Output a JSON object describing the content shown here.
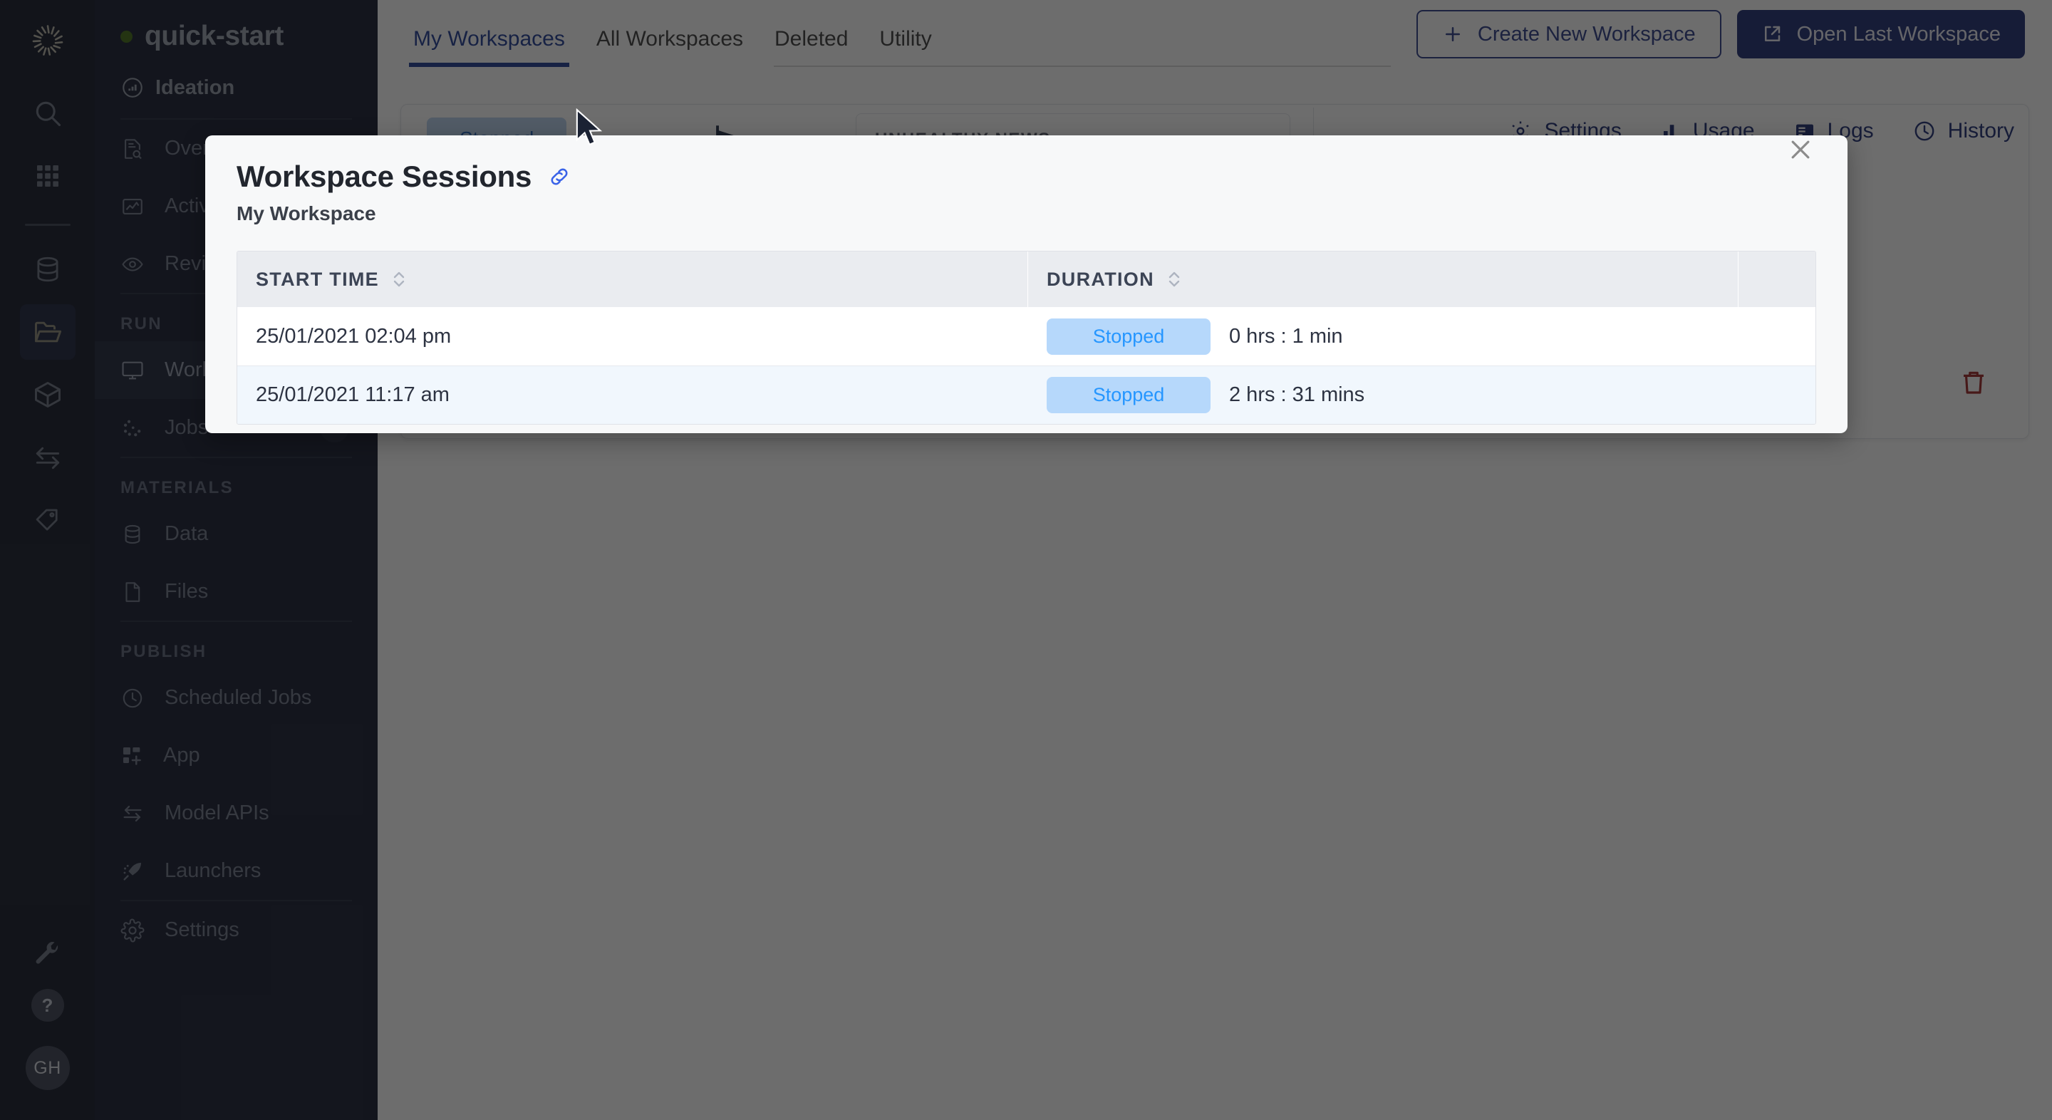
{
  "rail": {
    "logo_icon": "aperture-logo-icon",
    "items": [
      {
        "icon": "search-icon",
        "name": "search"
      },
      {
        "icon": "grid-apps-icon",
        "name": "apps"
      },
      {
        "icon": "database-icon",
        "name": "datasets"
      },
      {
        "icon": "folder-open-icon",
        "name": "projects",
        "active": true
      },
      {
        "icon": "cube-icon",
        "name": "environments"
      },
      {
        "icon": "arrows-exchange-icon",
        "name": "model-apis"
      },
      {
        "icon": "tag-icon",
        "name": "tags"
      },
      {
        "icon": "wrench-icon",
        "name": "admin"
      }
    ],
    "help_label": "?",
    "avatar_initials": "GH"
  },
  "sidebar": {
    "project_name": "quick-start",
    "project_stage": "Ideation",
    "items_top": [
      {
        "label": "Overview",
        "icon": "document-search-icon"
      },
      {
        "label": "Activity",
        "icon": "activity-chart-icon"
      },
      {
        "label": "Review",
        "icon": "eye-icon"
      }
    ],
    "section_run": "RUN",
    "items_run": [
      {
        "label": "Workspaces",
        "icon": "monitor-icon",
        "active": true
      },
      {
        "label": "Jobs",
        "icon": "dots-spinner-icon",
        "badge": "+"
      }
    ],
    "section_materials": "MATERIALS",
    "items_materials": [
      {
        "label": "Data",
        "icon": "database-icon"
      },
      {
        "label": "Files",
        "icon": "file-icon"
      }
    ],
    "section_publish": "PUBLISH",
    "items_publish": [
      {
        "label": "Scheduled Jobs",
        "icon": "clock-icon"
      },
      {
        "label": "App",
        "icon": "app-grid-plus-icon"
      },
      {
        "label": "Model APIs",
        "icon": "arrows-exchange-icon"
      },
      {
        "label": "Launchers",
        "icon": "rocket-icon"
      }
    ],
    "items_footer": [
      {
        "label": "Settings",
        "icon": "gear-icon"
      }
    ]
  },
  "tabs": [
    {
      "label": "My Workspaces",
      "active": true
    },
    {
      "label": "All Workspaces",
      "active": false
    },
    {
      "label": "Deleted",
      "active": false
    },
    {
      "label": "Utility",
      "active": false
    }
  ],
  "top_actions": {
    "create_label": "Create New Workspace",
    "create_icon": "plus-icon",
    "open_label": "Open Last Workspace",
    "open_icon": "external-link-icon"
  },
  "workspace_card": {
    "status": "Stopped",
    "meta_title": "UNHEALTHY NEWS",
    "actions": [
      {
        "label": "Settings",
        "icon": "gear-icon"
      },
      {
        "label": "Usage",
        "icon": "bar-chart-icon"
      },
      {
        "label": "Logs",
        "icon": "logs-icon"
      },
      {
        "label": "History",
        "icon": "clock-icon"
      }
    ],
    "delete_icon": "trash-icon"
  },
  "modal": {
    "title": "Workspace Sessions",
    "link_icon": "link-icon",
    "subtitle": "My Workspace",
    "close_icon": "close-icon",
    "table": {
      "columns": [
        {
          "label": "START TIME",
          "sortable": true
        },
        {
          "label": "DURATION",
          "sortable": true
        },
        {
          "label": "",
          "sortable": false
        }
      ],
      "rows": [
        {
          "start_time": "25/01/2021 02:04 pm",
          "status": "Stopped",
          "duration": "0 hrs : 1 min"
        },
        {
          "start_time": "25/01/2021 11:17 am",
          "status": "Stopped",
          "duration": "2 hrs : 31 mins"
        }
      ]
    }
  },
  "colors": {
    "brand_navy": "#1b2a72",
    "accent_blue": "#2a3b86",
    "pill_bg": "#b6d8fb",
    "pill_text": "#2596ff",
    "sidebar_bg": "#131a2e",
    "rail_bg": "#111627",
    "status_green": "#3f6b12",
    "danger_red": "#9c2222"
  }
}
